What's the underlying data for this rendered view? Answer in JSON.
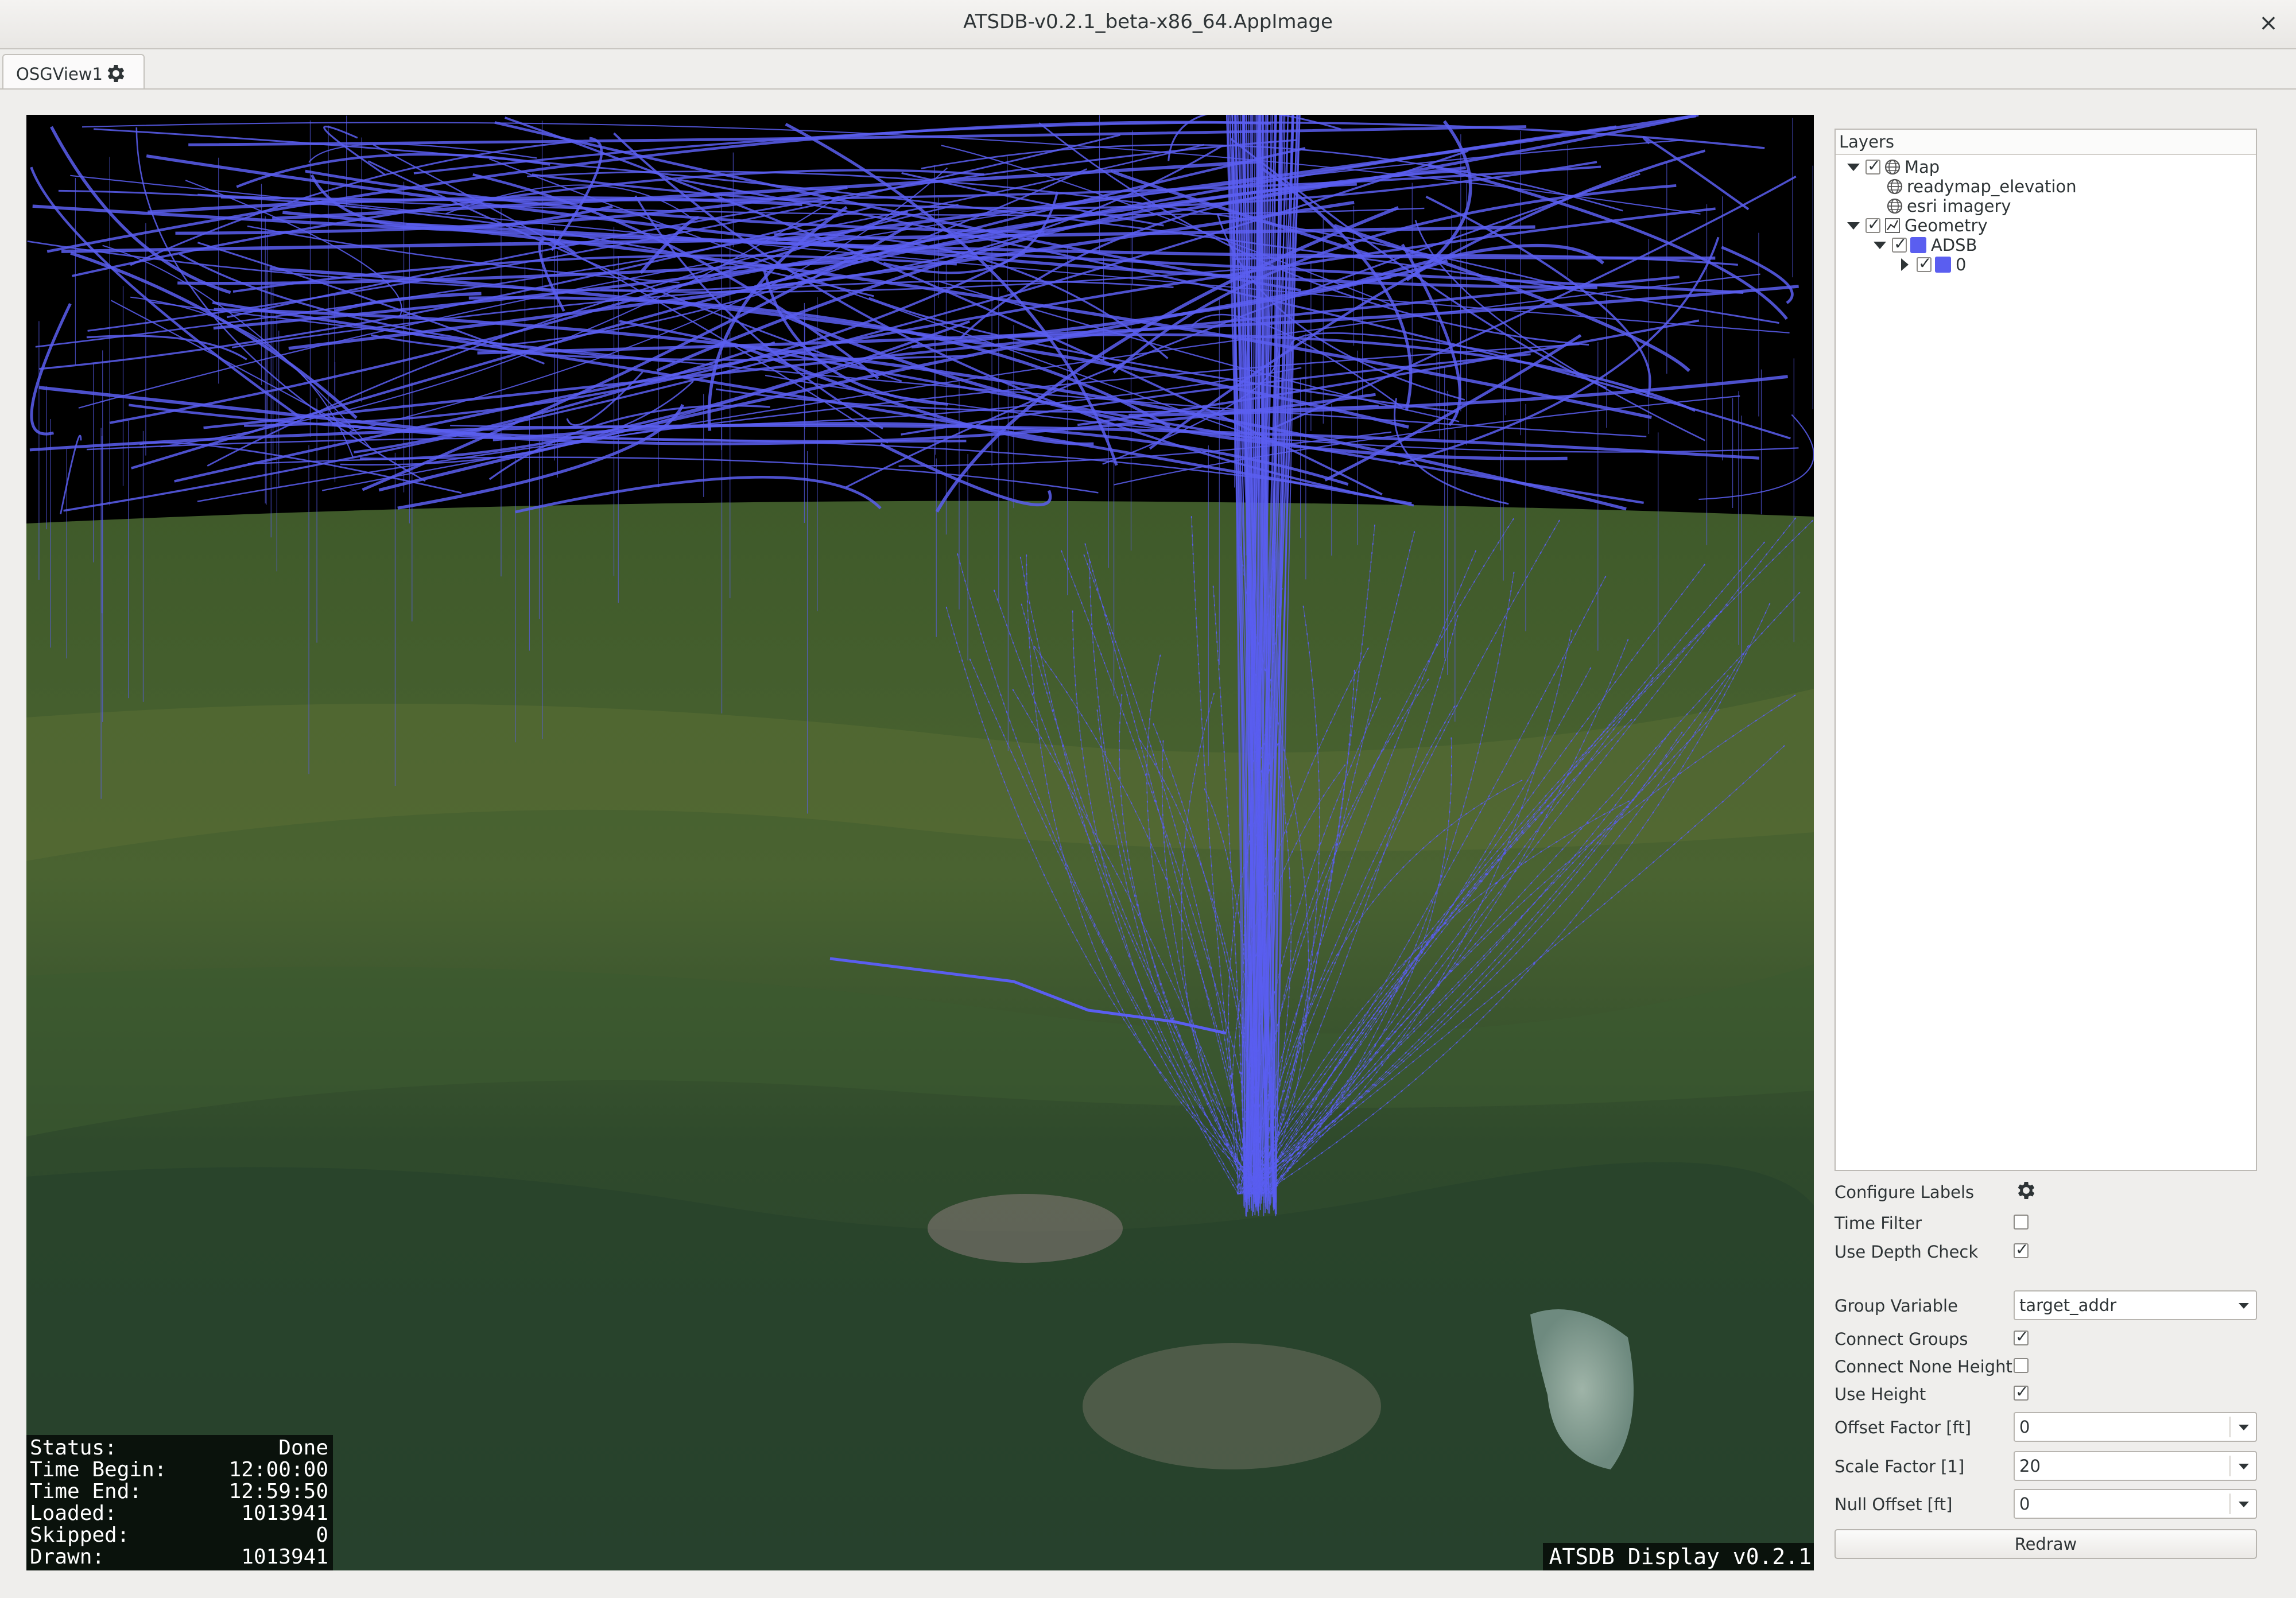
{
  "window": {
    "title": "ATSDB-v0.2.1_beta-x86_64.AppImage",
    "close_symbol": "×"
  },
  "tabs": [
    {
      "label": "OSGView1",
      "icon": "gear-icon"
    }
  ],
  "view": {
    "status": [
      {
        "label": "Status:",
        "value": "Done"
      },
      {
        "label": "Time Begin:",
        "value": "12:00:00"
      },
      {
        "label": "Time End:",
        "value": "12:59:50"
      },
      {
        "label": "Loaded:",
        "value": "1013941"
      },
      {
        "label": "Skipped:",
        "value": "0"
      },
      {
        "label": "Drawn:",
        "value": "1013941"
      }
    ],
    "watermark": "ATSDB Display v0.2.1",
    "track_color": "#5a5ef0"
  },
  "layers": {
    "header": "Layers",
    "tree": [
      {
        "label": "Map",
        "checked": true,
        "icon": "globe-icon",
        "expanded": true
      },
      {
        "label": "readymap_elevation",
        "icon": "globe-icon"
      },
      {
        "label": "esri imagery",
        "icon": "globe-icon"
      },
      {
        "label": "Geometry",
        "checked": true,
        "icon": "geometry-icon",
        "expanded": true
      },
      {
        "label": "ADSB",
        "checked": true,
        "color": "#5a5ef0",
        "expanded": true
      },
      {
        "label": "0",
        "checked": true,
        "color": "#5a5ef0",
        "expanded": false
      }
    ]
  },
  "controls": {
    "configure_labels": "Configure Labels",
    "time_filter": {
      "label": "Time Filter",
      "checked": false
    },
    "use_depth_check": {
      "label": "Use Depth Check",
      "checked": true
    },
    "group_variable": {
      "label": "Group Variable",
      "value": "target_addr"
    },
    "connect_groups": {
      "label": "Connect Groups",
      "checked": true
    },
    "connect_none_height": {
      "label": "Connect None Height",
      "checked": false
    },
    "use_height": {
      "label": "Use Height",
      "checked": true
    },
    "offset_factor": {
      "label": "Offset Factor [ft]",
      "value": "0"
    },
    "scale_factor": {
      "label": "Scale Factor [1]",
      "value": "20"
    },
    "null_offset": {
      "label": "Null Offset [ft]",
      "value": "0"
    },
    "redraw": "Redraw"
  }
}
